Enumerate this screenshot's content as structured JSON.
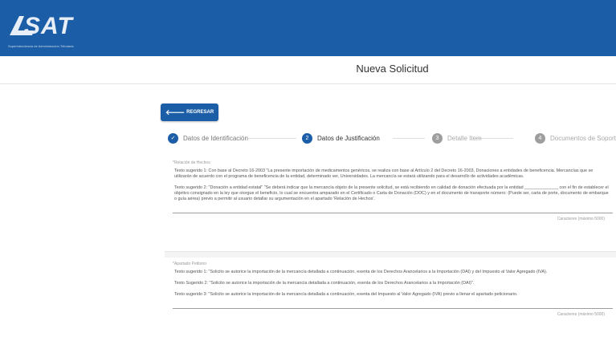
{
  "header": {
    "logo_text": "SAT",
    "logo_subtitle": "Superintendencia de Administración Tributaria"
  },
  "page": {
    "title": "Nueva Solicitud"
  },
  "toolbar": {
    "back_label": "REGRESAR"
  },
  "steps": [
    {
      "number": "✓",
      "label": "Datos de Identificación",
      "state": "done"
    },
    {
      "number": "2",
      "label": "Datos de Justificación",
      "state": "active"
    },
    {
      "number": "3",
      "label": "Detalle Item",
      "state": "pending"
    },
    {
      "number": "4",
      "label": "Documentos de Soporte",
      "state": "pending"
    }
  ],
  "relacion": {
    "label": "*Relación de Hechos",
    "p1": "Texto sugerido 1: Con base al Decreto 16-2003 \"La presente importación de medicamentos genéricos, se realiza con base al Artículo 2 del Decreto 16-2003, Donaciones a entidades de beneficencia. Mercancías que se utilizarán de acuerdo con el programa de beneficencia de la entidad, determinado ver, Universidades. La mercancía se estará utilizando para el desarrollo de actividades académicas.",
    "p2": "Texto sugerido 2: \"Donación a entidad estatal\" \"Se deberá indicar que la mercancía objeto de la presente solicitud, se está recibiendo en calidad de donación efectuada por la entidad ______________ con el fin de establecer el objetivo consignado en la ley que otorgue el beneficio, lo cual se encuentra amparado en el Certificado o Carta de Donación (DOC) y en el documento de transporte número: (Puede ser, carta de porte, documento de embarque o guía aérea) previo a permitir al usuario detallar su argumentación en el apartado 'Relación de Hechos'.",
    "counter": "Caracteres (máximo 5000)"
  },
  "peticion": {
    "label": "*Apartado Petitorio",
    "p1": "Texto sugerido 1: \"Solicito se autorice la importación de la mercancía detallada a continuación, exenta de los Derechos Arancelarios a la Importación (DAI) y del Impuesto al Valor Agregado (IVA).",
    "p2": "Texto Sugerido 2: \"Solicito se autorice la importación de la mercancía detallada a continuación, exenta de los Derechos Arancelarios a la Importación (DAI)\".",
    "p3": "Texto sugerido 3: \"Solicito se autorice la importación de la mercancía detallada a continuación, exenta del Impuesto al Valor Agregado (IVA) previo a llenar el apartado peticionario.",
    "counter": "Caracteres (máximo 5000)"
  },
  "colors": {
    "brand": "#1b5ea7",
    "pending": "#9e9e9e"
  }
}
